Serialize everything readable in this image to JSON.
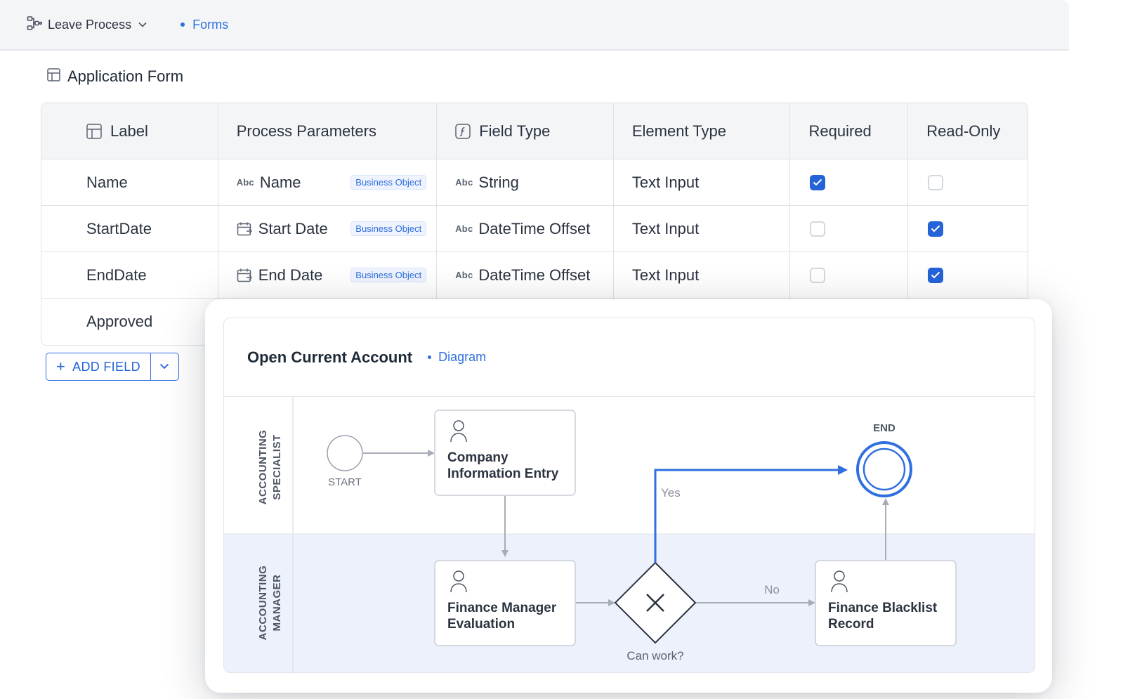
{
  "topbar": {
    "process_label": "Leave Process",
    "breadcrumb": "Forms"
  },
  "form": {
    "title": "Application Form",
    "columns": [
      "Label",
      "Process Parameters",
      "Field Type",
      "Element Type",
      "Required",
      "Read-Only"
    ],
    "rows": [
      {
        "label": "Name",
        "param": "Name",
        "param_icon": "abc-icon",
        "badge": "Business Object",
        "field_type": "String",
        "element_type": "Text Input",
        "required": true,
        "read_only": false
      },
      {
        "label": "StartDate",
        "param": "Start Date",
        "param_icon": "calendar-icon",
        "badge": "Business Object",
        "field_type": "DateTime Offset",
        "element_type": "Text Input",
        "required": false,
        "read_only": true
      },
      {
        "label": "EndDate",
        "param": "End Date",
        "param_icon": "calendar-icon",
        "badge": "Business Object",
        "field_type": "DateTime Offset",
        "element_type": "Text Input",
        "required": false,
        "read_only": true
      },
      {
        "label": "Approved"
      }
    ],
    "abc_glyph": "Abc",
    "add_field_label": "ADD FIELD"
  },
  "diagram": {
    "title": "Open Current Account",
    "breadcrumb": "Diagram",
    "lanes": [
      {
        "line1": "ACCOUNTING",
        "line2": "SPECIALIST"
      },
      {
        "line1": "ACCOUNTING",
        "line2": "MANAGER"
      }
    ],
    "start_label": "START",
    "end_label": "END",
    "tasks": {
      "company": [
        "Company",
        "Information Entry"
      ],
      "finance_manager": [
        "Finance Manager",
        "Evaluation"
      ],
      "blacklist": [
        "Finance Blacklist",
        "Record"
      ]
    },
    "gateway_label": "Can work?",
    "yes_label": "Yes",
    "no_label": "No",
    "colors": {
      "accent": "#2f6fe0",
      "lane_bg": "#edf1fb",
      "connector": "#a7adb8"
    }
  }
}
